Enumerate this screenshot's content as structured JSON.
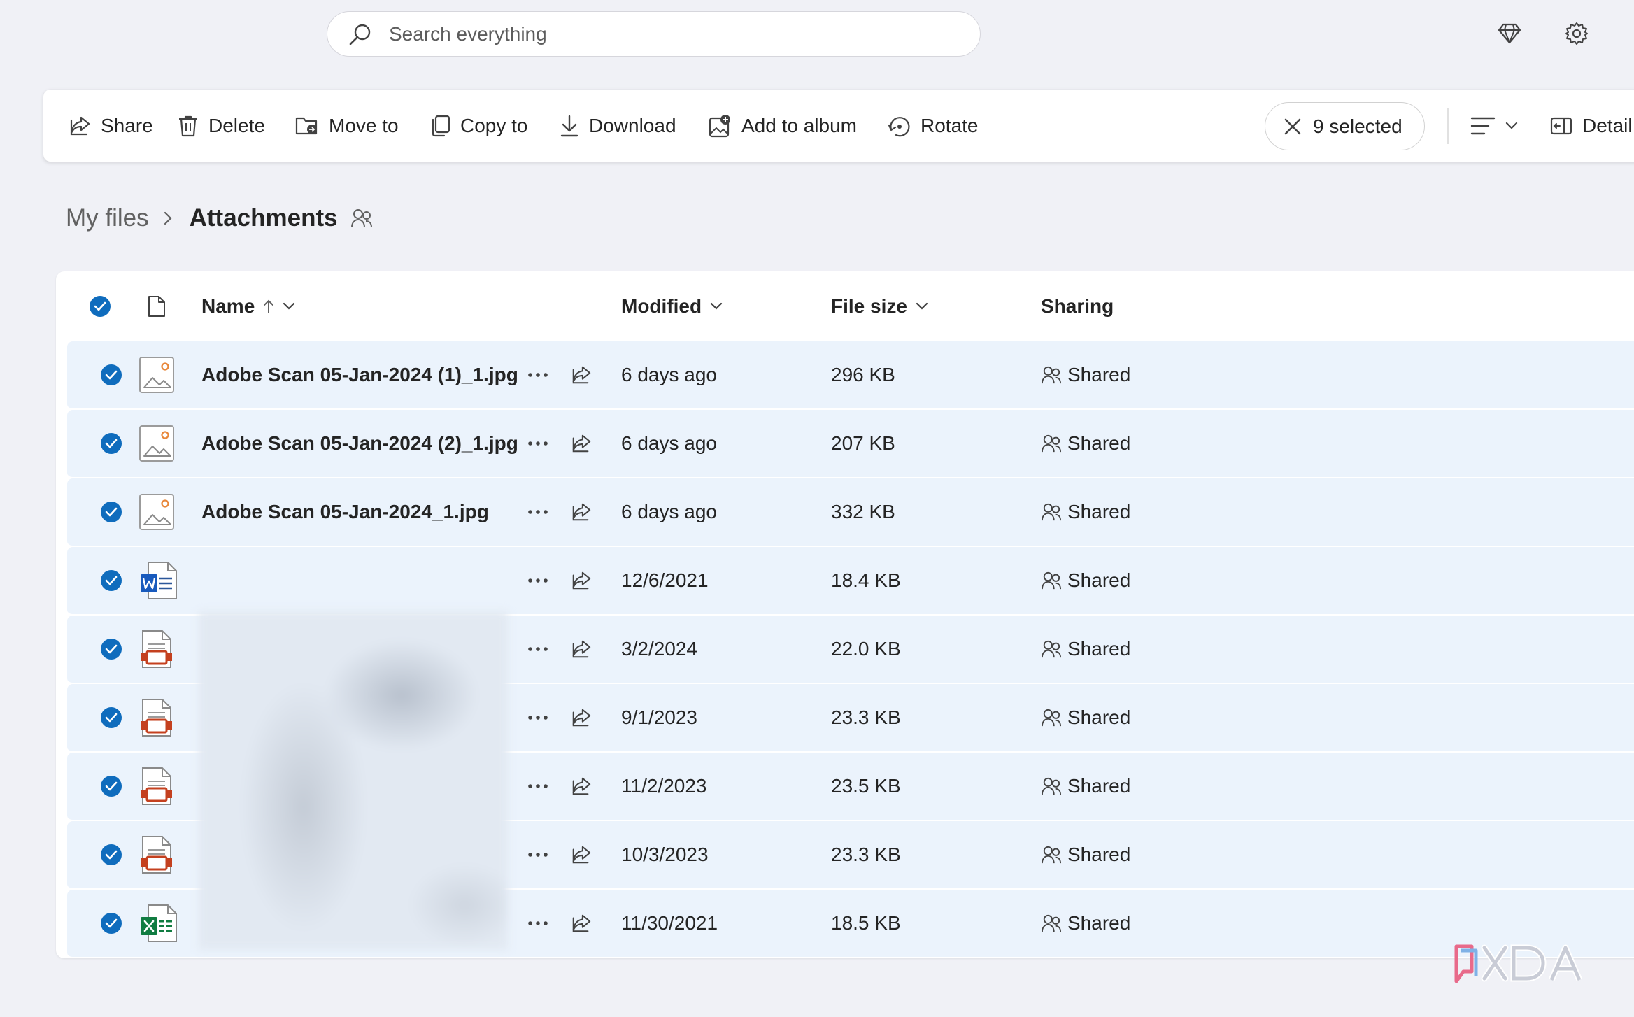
{
  "search": {
    "placeholder": "Search everything"
  },
  "top_icons": [
    "premium-diamond-icon",
    "settings-gear-icon"
  ],
  "command_bar": {
    "actions": [
      {
        "label": "Share",
        "icon": "share-icon"
      },
      {
        "label": "Delete",
        "icon": "trash-icon"
      },
      {
        "label": "Move to",
        "icon": "folder-move-icon"
      },
      {
        "label": "Copy to",
        "icon": "copy-icon"
      },
      {
        "label": "Download",
        "icon": "download-icon"
      },
      {
        "label": "Add to album",
        "icon": "add-image-icon"
      },
      {
        "label": "Rotate",
        "icon": "rotate-icon"
      }
    ],
    "selected_label": "9 selected",
    "details_label": "Detail"
  },
  "breadcrumb": {
    "root": "My files",
    "current": "Attachments"
  },
  "columns": {
    "name": "Name",
    "modified": "Modified",
    "file_size": "File size",
    "sharing": "Sharing"
  },
  "files": [
    {
      "name": "Adobe Scan 05-Jan-2024 (1)_1.jpg",
      "type": "image",
      "modified": "6 days ago",
      "size": "296 KB",
      "sharing": "Shared"
    },
    {
      "name": "Adobe Scan 05-Jan-2024 (2)_1.jpg",
      "type": "image",
      "modified": "6 days ago",
      "size": "207 KB",
      "sharing": "Shared"
    },
    {
      "name": "Adobe Scan 05-Jan-2024_1.jpg",
      "type": "image",
      "modified": "6 days ago",
      "size": "332 KB",
      "sharing": "Shared"
    },
    {
      "name": "",
      "type": "word",
      "modified": "12/6/2021",
      "size": "18.4 KB",
      "sharing": "Shared"
    },
    {
      "name": "",
      "type": "pdf",
      "modified": "3/2/2024",
      "size": "22.0 KB",
      "sharing": "Shared"
    },
    {
      "name": "",
      "type": "pdf",
      "modified": "9/1/2023",
      "size": "23.3 KB",
      "sharing": "Shared"
    },
    {
      "name": "",
      "type": "pdf",
      "modified": "11/2/2023",
      "size": "23.5 KB",
      "sharing": "Shared"
    },
    {
      "name": "",
      "type": "pdf",
      "modified": "10/3/2023",
      "size": "23.3 KB",
      "sharing": "Shared"
    },
    {
      "name": "",
      "type": "excel",
      "modified": "11/30/2021",
      "size": "18.5 KB",
      "sharing": "Shared"
    }
  ],
  "watermark": "XDA",
  "colors": {
    "accent": "#0f6cbd",
    "row_selected": "#ebf3fc",
    "background": "#f0f1f6"
  }
}
